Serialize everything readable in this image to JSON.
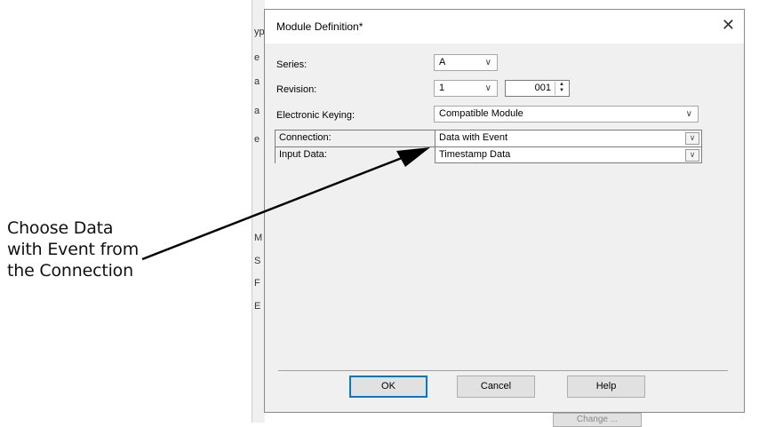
{
  "annotation": {
    "lines": [
      "Choose Data",
      "with Event from",
      "the Connection"
    ]
  },
  "background": {
    "chars": [
      "yp",
      "e",
      "a",
      "a",
      "e",
      "M",
      "S",
      "F",
      "E"
    ],
    "button_label": "Change ..."
  },
  "dialog": {
    "title": "Module Definition*",
    "close_label": "✕",
    "series": {
      "label": "Series:",
      "value": "A"
    },
    "revision": {
      "label": "Revision:",
      "major": "1",
      "minor": "001"
    },
    "keying": {
      "label": "Electronic Keying:",
      "value": "Compatible Module"
    },
    "grid": [
      {
        "name": "Connection:",
        "value": "Data with Event"
      },
      {
        "name": "Input Data:",
        "value": "Timestamp Data"
      }
    ],
    "buttons": {
      "ok": "OK",
      "cancel": "Cancel",
      "help": "Help"
    }
  },
  "icons": {
    "close": "close-icon",
    "dropdown": "chevron-down-icon",
    "spin": "spinner-arrows-icon",
    "arrow": "pointer-arrow"
  },
  "colors": {
    "dialog_bg": "#f0f0f0",
    "default_button_border": "#0078d7",
    "arrow": "#000000"
  }
}
